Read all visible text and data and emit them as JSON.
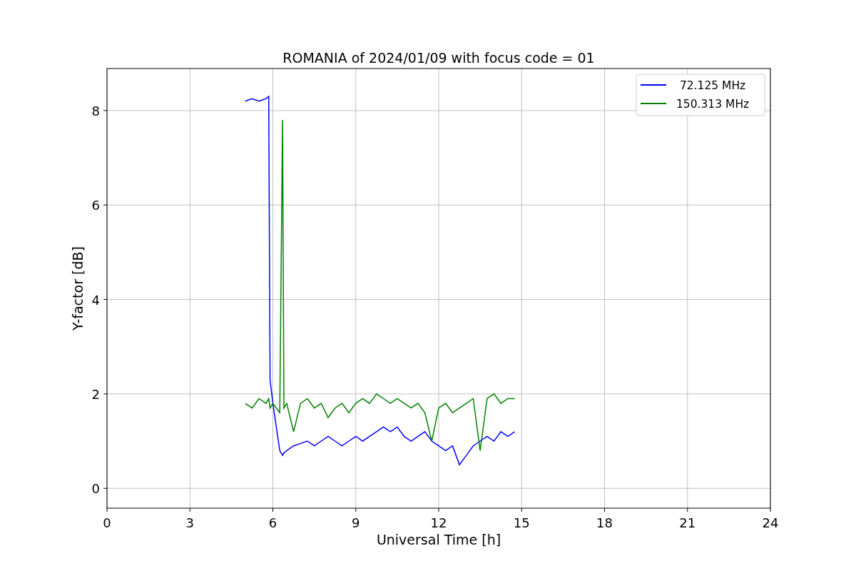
{
  "chart_data": {
    "type": "line",
    "title": "ROMANIA of 2024/01/09 with focus code = 01",
    "xlabel": "Universal Time [h]",
    "ylabel": "Y-factor [dB]",
    "x": [
      5,
      5.25,
      5.5,
      5.75,
      5.85,
      5.9,
      6.0,
      6.25,
      6.35,
      6.4,
      6.5,
      6.75,
      7,
      7.25,
      7.5,
      7.75,
      8,
      8.25,
      8.5,
      8.75,
      9,
      9.25,
      9.5,
      9.75,
      10,
      10.25,
      10.5,
      10.75,
      11,
      11.25,
      11.5,
      11.75,
      12,
      12.25,
      12.5,
      12.75,
      13,
      13.25,
      13.5,
      13.75,
      14,
      14.25,
      14.5,
      14.75
    ],
    "series": [
      {
        "name": " 72.125 MHz",
        "color": "#0000ff",
        "values": [
          8.2,
          8.25,
          8.2,
          8.25,
          8.3,
          2.3,
          1.8,
          0.8,
          0.7,
          0.75,
          0.8,
          0.9,
          0.95,
          1.0,
          0.9,
          1.0,
          1.1,
          1.0,
          0.9,
          1.0,
          1.1,
          1.0,
          1.1,
          1.2,
          1.3,
          1.2,
          1.3,
          1.1,
          1.0,
          1.1,
          1.2,
          1.0,
          0.9,
          0.8,
          0.9,
          0.5,
          0.7,
          0.9,
          1.0,
          1.1,
          1.0,
          1.2,
          1.1,
          1.2
        ]
      },
      {
        "name": "150.313 MHz",
        "color": "#008000",
        "values": [
          1.8,
          1.7,
          1.9,
          1.8,
          1.9,
          1.7,
          1.8,
          1.6,
          7.8,
          1.7,
          1.8,
          1.2,
          1.8,
          1.9,
          1.7,
          1.8,
          1.5,
          1.7,
          1.8,
          1.6,
          1.8,
          1.9,
          1.8,
          2.0,
          1.9,
          1.8,
          1.9,
          1.8,
          1.7,
          1.8,
          1.6,
          1.0,
          1.7,
          1.8,
          1.6,
          1.7,
          1.8,
          1.9,
          0.8,
          1.9,
          2.0,
          1.8,
          1.9,
          1.9
        ]
      }
    ],
    "grid": true,
    "legend": "upper right",
    "xlim": [
      0,
      24
    ],
    "ylim": [
      -0.42,
      8.89
    ],
    "xticks": [
      0,
      3,
      6,
      9,
      12,
      15,
      18,
      21,
      24
    ],
    "yticks": [
      0,
      2,
      4,
      6,
      8
    ]
  }
}
